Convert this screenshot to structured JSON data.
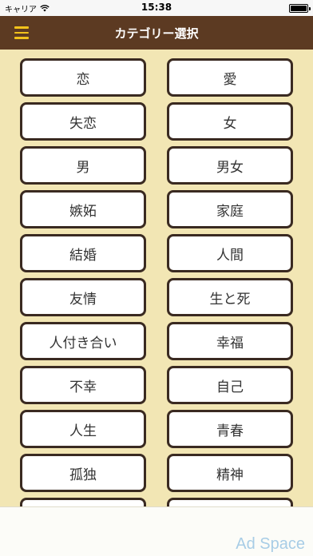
{
  "status_bar": {
    "carrier": "キャリア",
    "time": "15:38",
    "battery_level": 1.0
  },
  "nav": {
    "title": "カテゴリー選択",
    "menu_icon": "hamburger-menu-icon"
  },
  "categories": [
    "恋",
    "愛",
    "失恋",
    "女",
    "男",
    "男女",
    "嫉妬",
    "家庭",
    "結婚",
    "人間",
    "友情",
    "生と死",
    "人付き合い",
    "幸福",
    "不幸",
    "自己",
    "人生",
    "青春",
    "孤独",
    "精神",
    "",
    ""
  ],
  "ad": {
    "label": "Ad Space"
  },
  "colors": {
    "nav_background": "#5c3a22",
    "menu_icon": "#f2c21b",
    "page_background": "#f2e6b4",
    "button_border": "#3a2a21"
  }
}
